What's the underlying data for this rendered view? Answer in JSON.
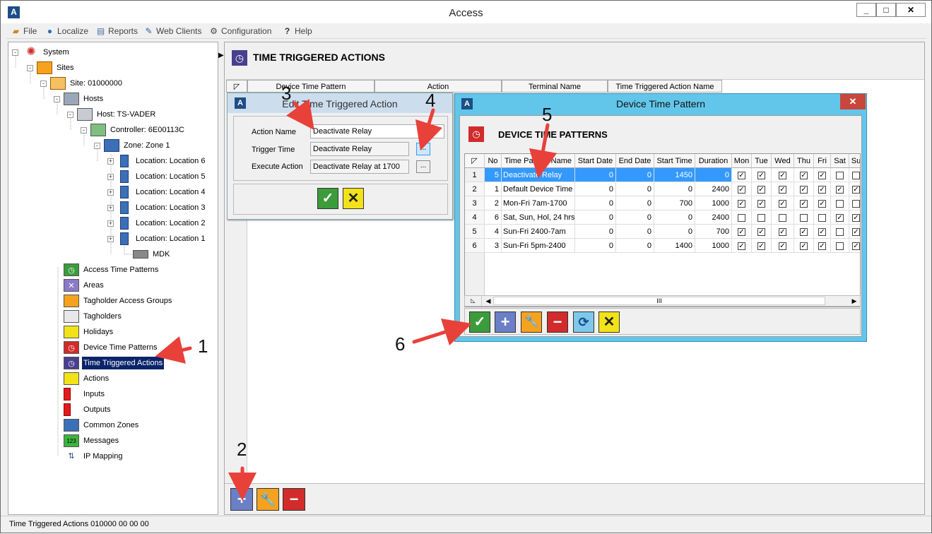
{
  "app": {
    "title": "Access",
    "window_buttons": [
      "_",
      "□",
      "✕"
    ]
  },
  "menu": [
    {
      "label": "File",
      "icon": "folder-icon"
    },
    {
      "label": "Localize",
      "icon": "globe-icon"
    },
    {
      "label": "Reports",
      "icon": "reports-icon"
    },
    {
      "label": "Web Clients",
      "icon": "web-clients-icon"
    },
    {
      "label": "Configuration",
      "icon": "gears-icon"
    },
    {
      "label": "Help",
      "icon": "help-icon"
    }
  ],
  "tree": {
    "system": "System",
    "sites": "Sites",
    "site": "Site: 01000000",
    "hosts": "Hosts",
    "host": "Host: TS-VADER",
    "controller": "Controller: 6E00113C",
    "zone": "Zone: Zone 1",
    "locations": [
      "Location: Location 6",
      "Location: Location 5",
      "Location: Location 4",
      "Location: Location 3",
      "Location: Location 2",
      "Location: Location 1"
    ],
    "mdk": "MDK",
    "items": [
      "Access Time Patterns",
      "Areas",
      "Tagholder Access Groups",
      "Tagholders",
      "Holidays",
      "Device Time Patterns",
      "Time Triggered Actions",
      "Actions",
      "Inputs",
      "Outputs",
      "Common Zones",
      "Messages",
      "IP Mapping"
    ],
    "selected": "Time Triggered Actions"
  },
  "main": {
    "title": "TIME TRIGGERED ACTIONS",
    "columns": [
      "Device Time Pattern",
      "Action",
      "Terminal Name",
      "Time Triggered Action Name"
    ]
  },
  "edit_dialog": {
    "title": "Edit Time Triggered Action",
    "action_name_label": "Action Name",
    "action_name_value": "Deactivate Relay",
    "trigger_time_label": "Trigger Time",
    "trigger_time_value": "Deactivate Relay",
    "execute_action_label": "Execute Action",
    "execute_action_value": "Deactivate Relay at 1700",
    "browse_label": "..."
  },
  "dtp_dialog": {
    "title": "Device Time Pattern",
    "heading": "DEVICE TIME PATTERNS",
    "columns": [
      "No",
      "Time Pattern Name",
      "Start Date",
      "End Date",
      "Start Time",
      "Duration",
      "Mon",
      "Tue",
      "Wed",
      "Thu",
      "Fri",
      "Sat",
      "Su"
    ],
    "rows": [
      {
        "idx": "1",
        "no": "5",
        "name": "Deactivate Relay",
        "start_date": "0",
        "end_date": "0",
        "start_time": "1450",
        "duration": "0",
        "days": [
          true,
          true,
          true,
          true,
          true,
          false,
          false
        ],
        "selected": true
      },
      {
        "idx": "2",
        "no": "1",
        "name": "Default Device Time",
        "start_date": "0",
        "end_date": "0",
        "start_time": "0",
        "duration": "2400",
        "days": [
          true,
          true,
          true,
          true,
          true,
          true,
          true
        ]
      },
      {
        "idx": "3",
        "no": "2",
        "name": "Mon-Fri 7am-1700",
        "start_date": "0",
        "end_date": "0",
        "start_time": "700",
        "duration": "1000",
        "days": [
          true,
          true,
          true,
          true,
          true,
          false,
          false
        ]
      },
      {
        "idx": "4",
        "no": "6",
        "name": "Sat, Sun, Hol, 24 hrs",
        "start_date": "0",
        "end_date": "0",
        "start_time": "0",
        "duration": "2400",
        "days": [
          false,
          false,
          false,
          false,
          false,
          true,
          true
        ]
      },
      {
        "idx": "5",
        "no": "4",
        "name": "Sun-Fri 2400-7am",
        "start_date": "0",
        "end_date": "0",
        "start_time": "0",
        "duration": "700",
        "days": [
          true,
          true,
          true,
          true,
          true,
          false,
          true
        ]
      },
      {
        "idx": "6",
        "no": "3",
        "name": "Sun-Fri 5pm-2400",
        "start_date": "0",
        "end_date": "0",
        "start_time": "1400",
        "duration": "1000",
        "days": [
          true,
          true,
          true,
          true,
          true,
          false,
          true
        ]
      }
    ],
    "scroll_mid": "III"
  },
  "annotations": [
    "1",
    "2",
    "3",
    "4",
    "5",
    "6"
  ],
  "status": "Time Triggered Actions 010000 00 00 00"
}
